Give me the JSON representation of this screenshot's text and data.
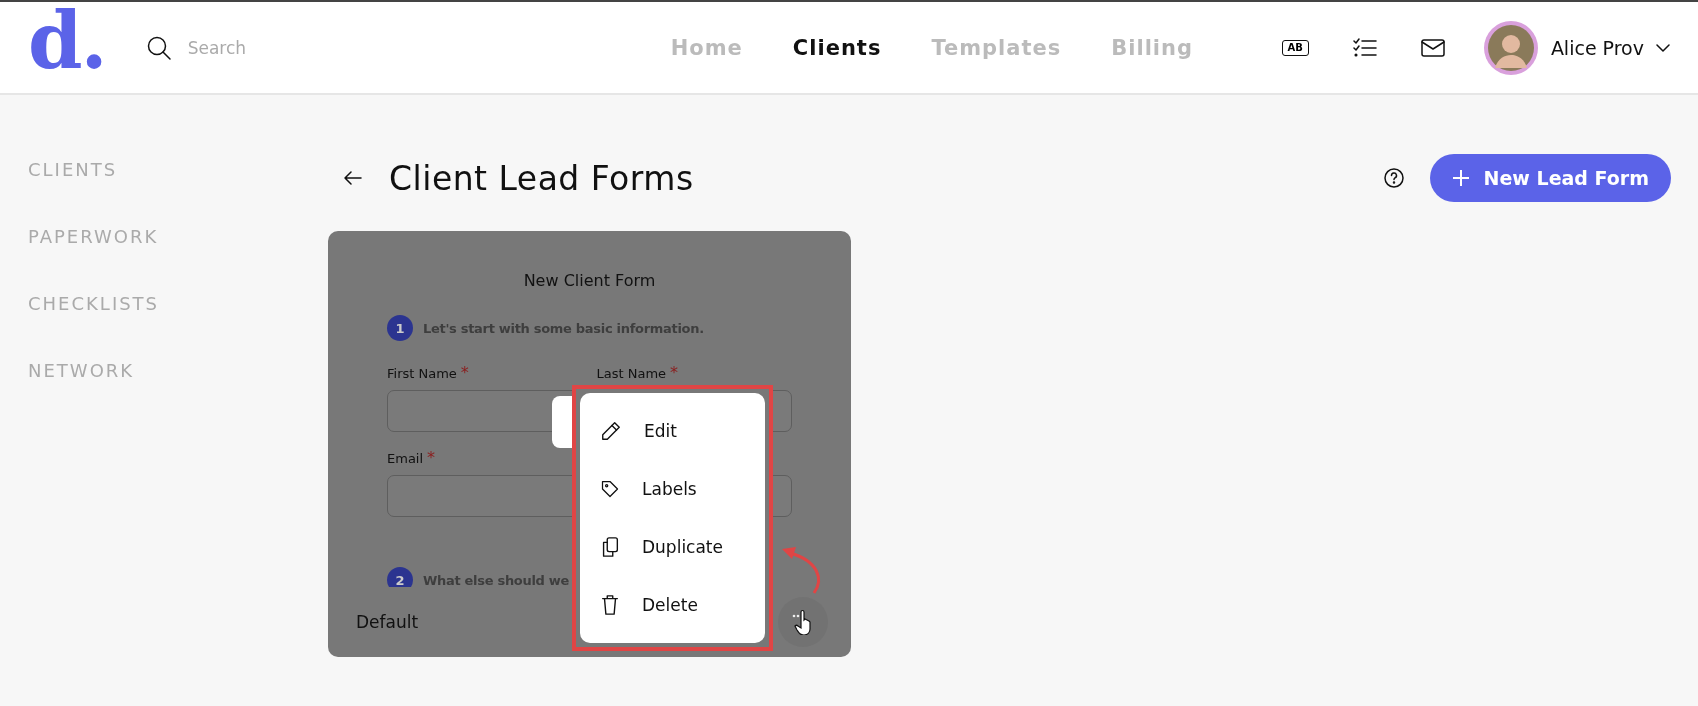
{
  "header": {
    "logo": "d.",
    "search": {
      "placeholder": "Search"
    },
    "nav": [
      {
        "label": "Home",
        "selected": false
      },
      {
        "label": "Clients",
        "selected": true
      },
      {
        "label": "Templates",
        "selected": false
      },
      {
        "label": "Billing",
        "selected": false
      }
    ],
    "badge_icon_text": "AB",
    "user": {
      "name": "Alice Prov"
    }
  },
  "sidebar": {
    "items": [
      "CLIENTS",
      "PAPERWORK",
      "CHECKLISTS",
      "NETWORK"
    ]
  },
  "page": {
    "title": "Client Lead Forms",
    "new_button": "New Lead Form"
  },
  "card": {
    "preview": {
      "title": "New Client Form",
      "steps": [
        {
          "number": "1",
          "text": "Let's start with some basic information."
        },
        {
          "number": "2",
          "text": "What else should we"
        }
      ],
      "fields": [
        {
          "label": "First Name",
          "mark": "*"
        },
        {
          "label": "Last Name",
          "mark": "*"
        },
        {
          "label": "Email",
          "mark": "*"
        }
      ]
    },
    "label": "Default",
    "menu": [
      {
        "kind": "edit",
        "label": "Edit"
      },
      {
        "kind": "labels",
        "label": "Labels"
      },
      {
        "kind": "duplicate",
        "label": "Duplicate"
      },
      {
        "kind": "delete",
        "label": "Delete"
      }
    ]
  }
}
